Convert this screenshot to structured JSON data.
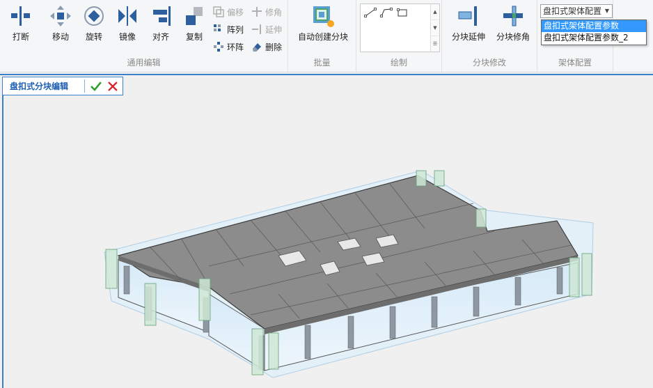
{
  "ribbon": {
    "groups": {
      "general_edit": "通用编辑",
      "batch": "批量",
      "draw": "绘制",
      "block_modify": "分块修改",
      "frame_config": "架体配置"
    },
    "buttons": {
      "break": "打断",
      "move": "移动",
      "rotate": "旋转",
      "mirror": "镜像",
      "align": "对齐",
      "copy": "复制",
      "offset": "偏移",
      "trim": "修角",
      "array": "阵列",
      "extend": "延伸",
      "ring_array": "环阵",
      "delete": "删除",
      "auto_create_block": "自动创建分块",
      "block_extend": "分块延伸",
      "block_trim": "分块修角"
    },
    "config_combo": {
      "value": "盘扣式架体配置",
      "options": [
        "盘扣式架体配置参数",
        "盘扣式架体配置参数_2"
      ]
    }
  },
  "edit_bar": {
    "title": "盘扣式分块编辑"
  },
  "colors": {
    "accent": "#3a7fcc",
    "ok": "#2e9e2e",
    "cancel": "#d9252e",
    "icon_blue": "#2d5f9e"
  }
}
